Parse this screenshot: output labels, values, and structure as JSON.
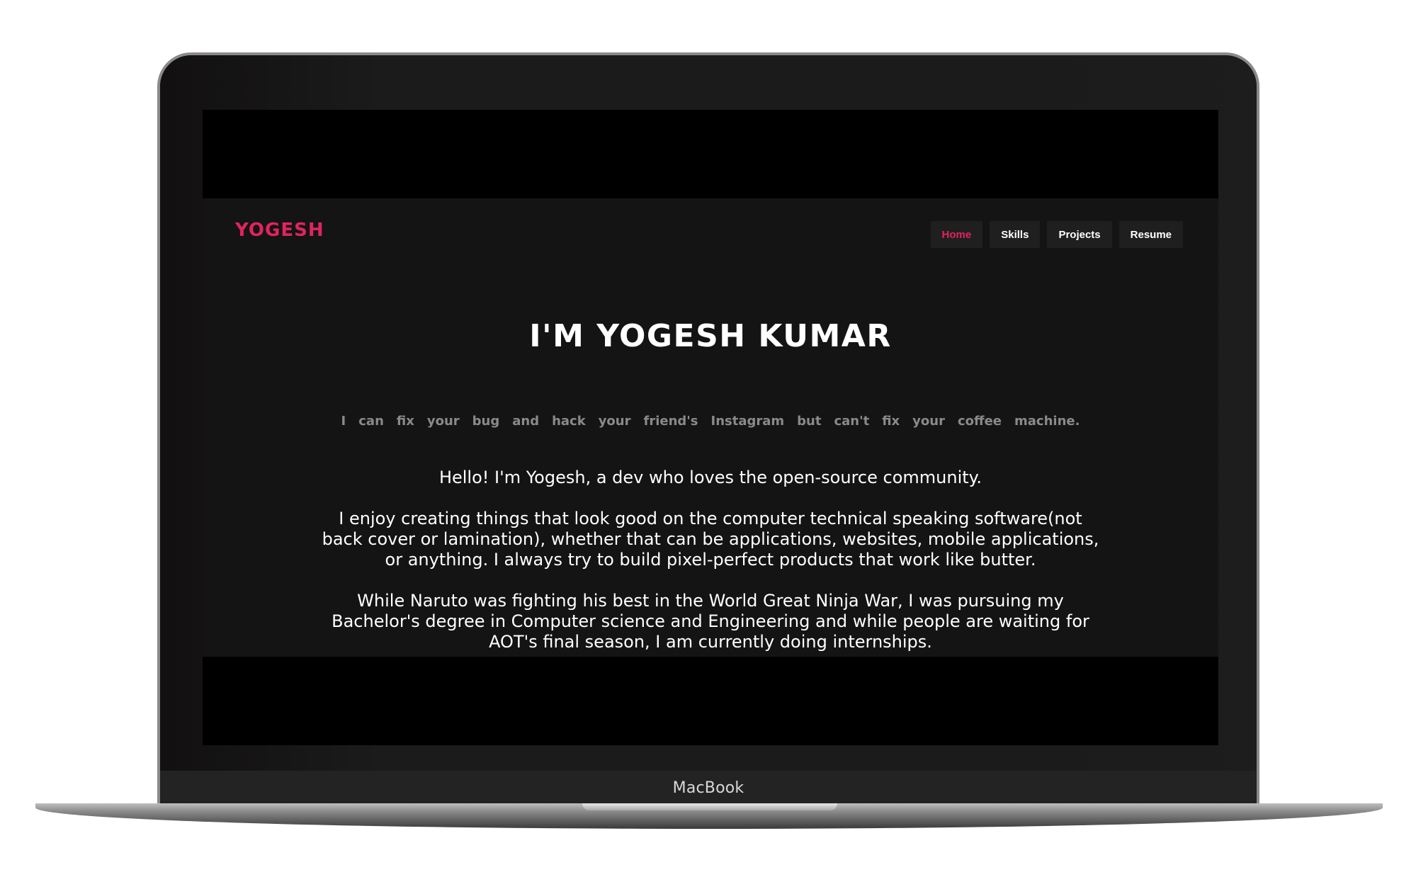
{
  "device": {
    "chin_label": "MacBook"
  },
  "site": {
    "logo": "YOGESH",
    "nav": [
      {
        "label": "Home",
        "active": true
      },
      {
        "label": "Skills",
        "active": false
      },
      {
        "label": "Projects",
        "active": false
      },
      {
        "label": "Resume",
        "active": false
      }
    ],
    "hero_title": "I'M YOGESH KUMAR",
    "tagline_words": [
      "I",
      "can",
      "fix",
      "your",
      "bug",
      "and",
      "hack",
      "your",
      "friend's",
      "Instagram",
      "but",
      "can't",
      "fix",
      "your",
      "coffee",
      "machine."
    ],
    "about": [
      "Hello! I'm Yogesh, a dev who loves the open-source community.",
      "I enjoy creating things that look good on the computer technical speaking software(not back cover or lamination), whether that can be applications, websites, mobile applications, or anything. I always try to build pixel-perfect products that work like butter.",
      "While Naruto was fighting his best in the World Great Ninja War, I was pursuing my Bachelor's degree in Computer science and Engineering and while people are waiting for AOT's final season, I am currently doing internships."
    ]
  },
  "colors": {
    "accent": "#e0245e",
    "site_background": "#141414",
    "nav_button_background": "#1f1f1f",
    "tagline": "#8a8a8a"
  }
}
